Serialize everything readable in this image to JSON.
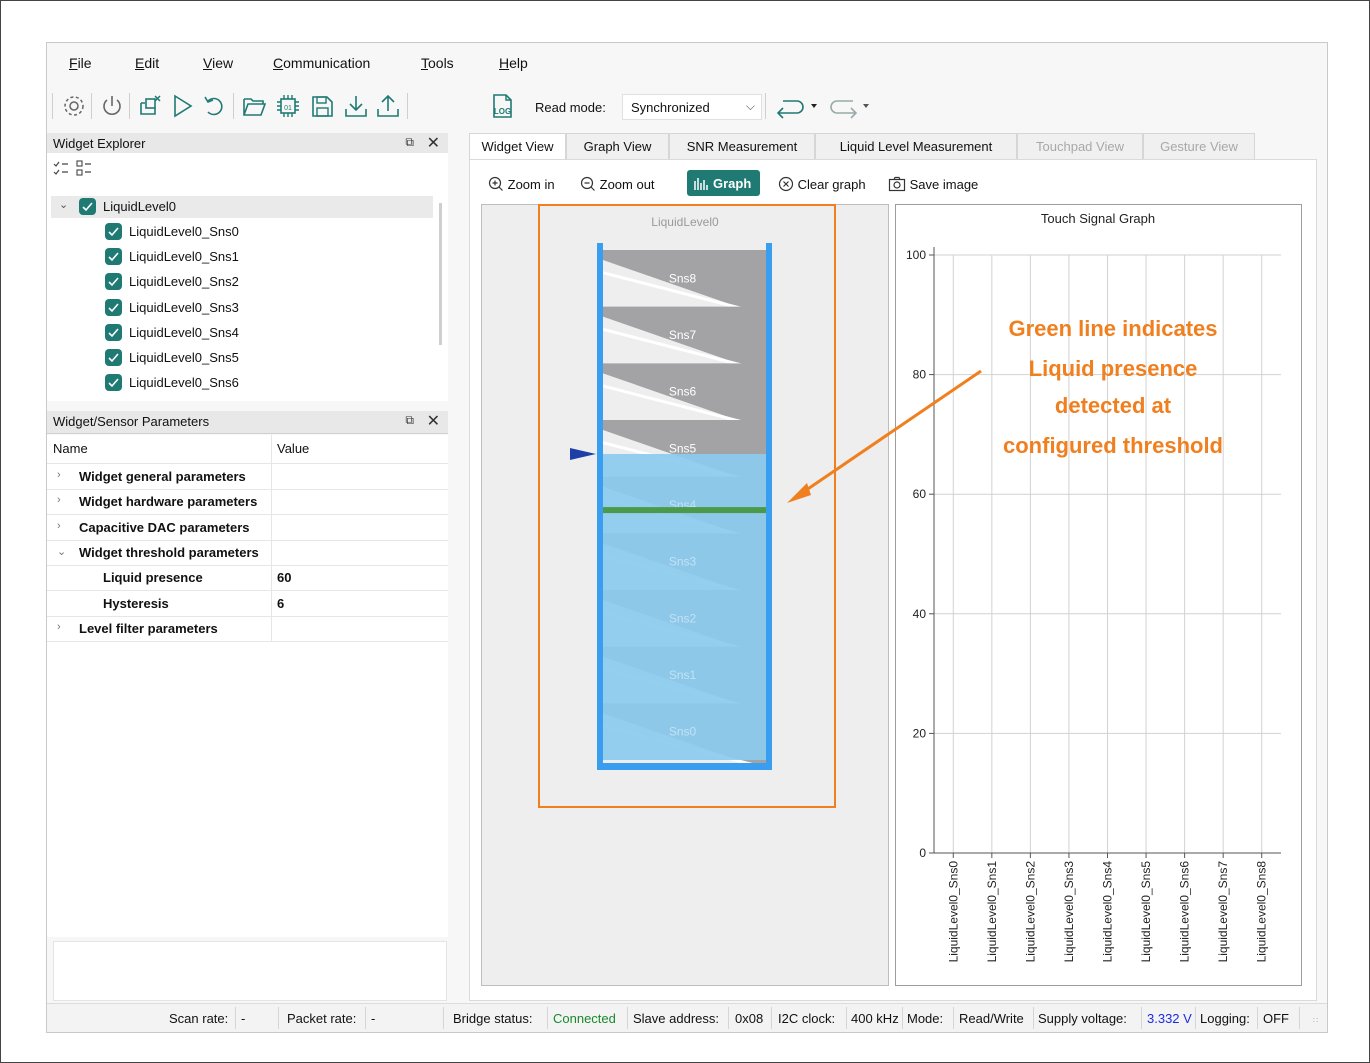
{
  "menu": {
    "file": {
      "u": "F",
      "rest": "ile"
    },
    "edit": {
      "u": "E",
      "rest": "dit"
    },
    "view": {
      "u": "V",
      "rest": "iew"
    },
    "communication": {
      "u": "C",
      "rest": "ommunication"
    },
    "tools": {
      "u": "T",
      "rest": "ools"
    },
    "help": {
      "u": "H",
      "rest": "elp"
    }
  },
  "toolbar": {
    "icons": [
      "gear-icon",
      "power-icon",
      "clear-icon",
      "play-icon",
      "reset-icon",
      "open-folder-icon",
      "chip-icon",
      "save-icon",
      "download-icon",
      "upload-icon",
      "log-icon"
    ],
    "read_mode_label": "Read mode:",
    "read_mode_value": "Synchronized",
    "log_label": "LOG"
  },
  "widget_explorer": {
    "title": "Widget Explorer",
    "root": "LiquidLevel0",
    "items": [
      "LiquidLevel0_Sns0",
      "LiquidLevel0_Sns1",
      "LiquidLevel0_Sns2",
      "LiquidLevel0_Sns3",
      "LiquidLevel0_Sns4",
      "LiquidLevel0_Sns5",
      "LiquidLevel0_Sns6"
    ]
  },
  "params": {
    "title": "Widget/Sensor Parameters",
    "col_name": "Name",
    "col_value": "Value",
    "rows": [
      {
        "name": "Widget general parameters",
        "value": ""
      },
      {
        "name": "Widget hardware parameters",
        "value": ""
      },
      {
        "name": "Capacitive DAC parameters",
        "value": ""
      },
      {
        "name": "Widget threshold parameters",
        "value": ""
      },
      {
        "name": "Liquid presence",
        "value": "60"
      },
      {
        "name": "Hysteresis",
        "value": "6"
      },
      {
        "name": "Level filter parameters",
        "value": ""
      }
    ]
  },
  "tabs": [
    "Widget View",
    "Graph View",
    "SNR Measurement",
    "Liquid Level Measurement",
    "Touchpad View",
    "Gesture View"
  ],
  "view_tools": {
    "zoom_in": "Zoom in",
    "zoom_out": "Zoom out",
    "graph": "Graph",
    "clear_graph": "Clear graph",
    "save_image": "Save image"
  },
  "liquid_level": {
    "title": "LiquidLevel0",
    "sensors": [
      "Sns8",
      "Sns7",
      "Sns6",
      "Sns5",
      "Sns4",
      "Sns3",
      "Sns2",
      "Sns1",
      "Sns0"
    ],
    "liquid_level_fraction": 0.6,
    "threshold_fraction": 0.49,
    "liquid_color": "#8ccbee",
    "threshold_color": "#4a9a4a"
  },
  "annotation": {
    "lines": [
      "Green line indicates",
      "Liquid presence",
      "detected at",
      "configured threshold"
    ],
    "color": "#f07f1f"
  },
  "chart_data": {
    "type": "bar",
    "title": "Touch Signal Graph",
    "categories": [
      "LiquidLevel0_Sns0",
      "LiquidLevel0_Sns1",
      "LiquidLevel0_Sns2",
      "LiquidLevel0_Sns3",
      "LiquidLevel0_Sns4",
      "LiquidLevel0_Sns5",
      "LiquidLevel0_Sns6",
      "LiquidLevel0_Sns7",
      "LiquidLevel0_Sns8"
    ],
    "values": [
      0,
      0,
      0,
      0,
      0,
      0,
      0,
      0,
      0
    ],
    "ylim": [
      0,
      100
    ],
    "yticks": [
      0,
      20,
      40,
      60,
      80,
      100
    ],
    "grid": true
  },
  "status": {
    "scan_rate_label": "Scan rate:",
    "scan_rate": "-",
    "packet_rate_label": "Packet rate:",
    "packet_rate": "-",
    "bridge_label": "Bridge status:",
    "bridge": "Connected",
    "slave_label": "Slave address:",
    "slave": "0x08",
    "i2c_label": "I2C clock:",
    "i2c": "400 kHz",
    "mode_label": "Mode:",
    "mode": "Read/Write",
    "supply_label": "Supply voltage:",
    "supply": "3.332 V",
    "logging_label": "Logging:",
    "logging": "OFF",
    "bridge_color": "#188a2a",
    "supply_color": "#1b2be0"
  }
}
